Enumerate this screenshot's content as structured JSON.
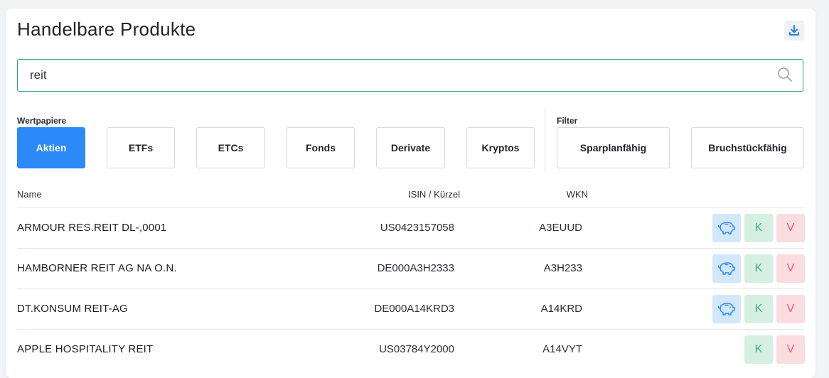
{
  "title": "Handelbare Produkte",
  "search": {
    "value": "reit",
    "placeholder": ""
  },
  "groups": {
    "wertpapiere": "Wertpapiere",
    "filter": "Filter"
  },
  "categories": [
    "Aktien",
    "ETFs",
    "ETCs",
    "Fonds",
    "Derivate",
    "Kryptos"
  ],
  "active_category": "Aktien",
  "filters": [
    "Sparplanfähig",
    "Bruchstückfähig"
  ],
  "columns": {
    "name": "Name",
    "isin": "ISIN / Kürzel",
    "wkn": "WKN"
  },
  "rows": [
    {
      "name": "ARMOUR RES.REIT DL-,0001",
      "isin": "US0423157058",
      "wkn": "A3EUUD",
      "sparplan": true
    },
    {
      "name": "HAMBORNER REIT AG NA O.N.",
      "isin": "DE000A3H2333",
      "wkn": "A3H233",
      "sparplan": true
    },
    {
      "name": "DT.KONSUM REIT-AG",
      "isin": "DE000A14KRD3",
      "wkn": "A14KRD",
      "sparplan": true
    },
    {
      "name": "APPLE HOSPITALITY REIT",
      "isin": "US03784Y2000",
      "wkn": "A14VYT",
      "sparplan": false
    }
  ],
  "actions": {
    "buy": "K",
    "sell": "V"
  },
  "colors": {
    "accent": "#2b8af7",
    "search_border": "#2e9e7e",
    "buy": "#3cb37e",
    "sell": "#ee5a68",
    "sparplan": "#2b8af7"
  },
  "icons": {
    "download": "download-icon",
    "search": "search-icon",
    "sparplan": "piggy-bank-icon"
  }
}
